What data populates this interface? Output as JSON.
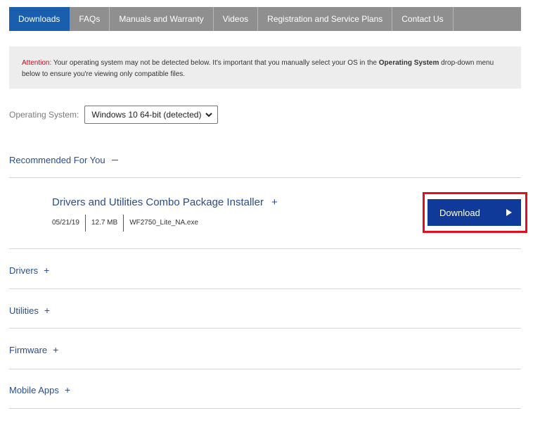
{
  "tabs": [
    {
      "label": "Downloads",
      "active": true
    },
    {
      "label": "FAQs",
      "active": false
    },
    {
      "label": "Manuals and Warranty",
      "active": false
    },
    {
      "label": "Videos",
      "active": false
    },
    {
      "label": "Registration and Service Plans",
      "active": false
    },
    {
      "label": "Contact Us",
      "active": false
    }
  ],
  "attention": {
    "label": "Attention:",
    "text_1": " Your operating system may not be detected below. It's important that you manually select your OS in the ",
    "bold": "Operating System",
    "text_2": " drop-down menu below to ensure you're viewing only compatible files."
  },
  "os": {
    "label": "Operating System:",
    "selected": "Windows 10 64-bit (detected)"
  },
  "recommended": {
    "heading": "Recommended For You"
  },
  "package": {
    "title": "Drivers and Utilities Combo Package Installer",
    "date": "05/21/19",
    "size": "12.7 MB",
    "filename": "WF2750_Lite_NA.exe",
    "download_label": "Download"
  },
  "sections": [
    {
      "label": "Drivers"
    },
    {
      "label": "Utilities"
    },
    {
      "label": "Firmware"
    },
    {
      "label": "Mobile Apps"
    }
  ],
  "colors": {
    "accent": "#1a5fae",
    "button": "#0f3a99",
    "highlight": "#e0101e",
    "link": "#2a4d8f"
  }
}
